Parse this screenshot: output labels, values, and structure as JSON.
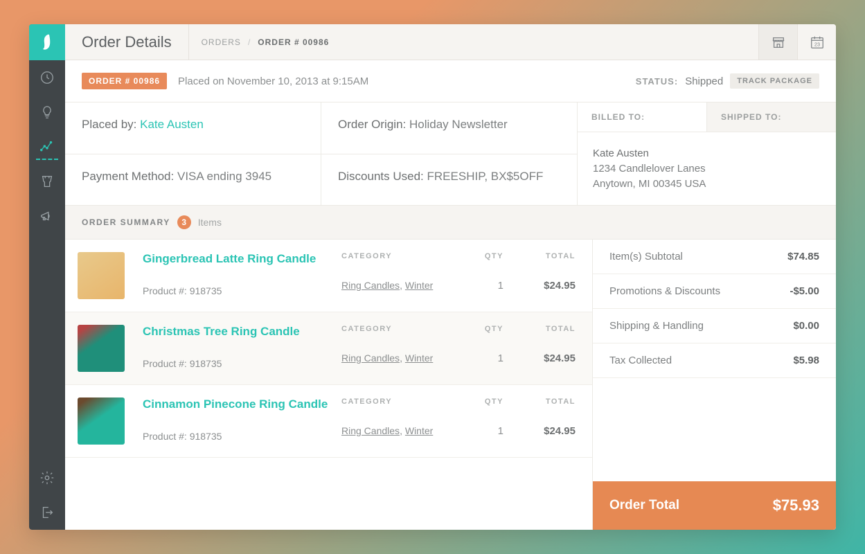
{
  "header": {
    "title": "Order Details",
    "crumb_root": "ORDERS",
    "crumb_current": "ORDER # 00986"
  },
  "order": {
    "badge": "ORDER # 00986",
    "placed_text": "Placed on November 10, 2013 at 9:15AM",
    "status_label": "STATUS:",
    "status_value": "Shipped",
    "track_label": "TRACK PACKAGE"
  },
  "info": {
    "placed_by_label": "Placed by:",
    "placed_by_value": "Kate Austen",
    "payment_label": "Payment Method:",
    "payment_value": "VISA ending 3945",
    "origin_label": "Order Origin:",
    "origin_value": "Holiday Newsletter",
    "discounts_label": "Discounts Used:",
    "discounts_value": "FREESHIP, BX$5OFF"
  },
  "address": {
    "billed_tab": "BILLED TO:",
    "shipped_tab": "SHIPPED TO:",
    "name": "Kate Austen",
    "line1": "1234 Candlelover Lanes",
    "line2": "Anytown, MI 00345 USA"
  },
  "summary": {
    "title": "ORDER SUMMARY",
    "count": "3",
    "items_label": "Items",
    "col_category": "CATEGORY",
    "col_qty": "QTY",
    "col_total": "TOTAL"
  },
  "items": [
    {
      "name": "Gingerbread Latte Ring Candle",
      "sku": "Product #: 918735",
      "cat1": "Ring Candles",
      "cat2": "Winter",
      "qty": "1",
      "total": "$24.95"
    },
    {
      "name": "Christmas Tree Ring Candle",
      "sku": "Product #: 918735",
      "cat1": "Ring Candles",
      "cat2": "Winter",
      "qty": "1",
      "total": "$24.95"
    },
    {
      "name": "Cinnamon Pinecone Ring Candle",
      "sku": "Product #: 918735",
      "cat1": "Ring Candles",
      "cat2": "Winter",
      "qty": "1",
      "total": "$24.95"
    }
  ],
  "totals": {
    "subtotal_label": "Item(s) Subtotal",
    "subtotal_value": "$74.85",
    "promo_label": "Promotions &  Discounts",
    "promo_value": "-$5.00",
    "ship_label": "Shipping & Handling",
    "ship_value": "$0.00",
    "tax_label": "Tax Collected",
    "tax_value": "$5.98",
    "grand_label": "Order Total",
    "grand_value": "$75.93"
  }
}
